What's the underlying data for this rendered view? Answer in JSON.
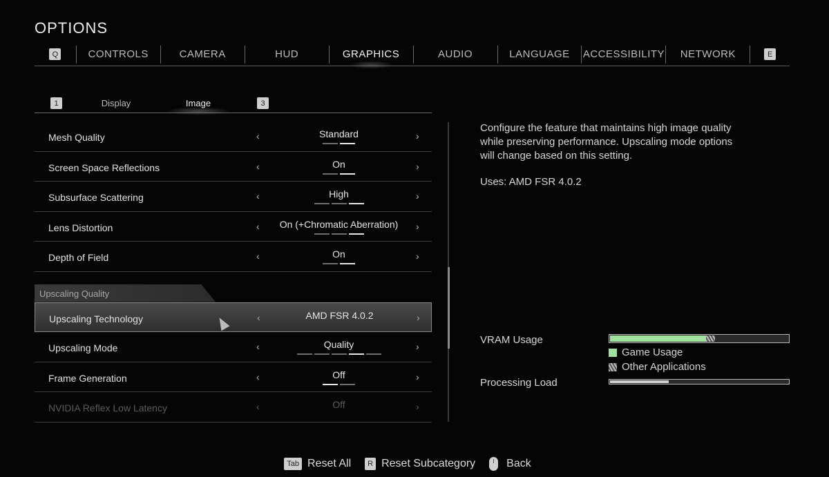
{
  "header": {
    "title": "OPTIONS"
  },
  "topnav": {
    "left_key": "Q",
    "right_key": "E",
    "tabs": [
      "CONTROLS",
      "CAMERA",
      "HUD",
      "GRAPHICS",
      "AUDIO",
      "LANGUAGE",
      "ACCESSIBILITY",
      "NETWORK"
    ],
    "active": "GRAPHICS"
  },
  "subnav": {
    "left_key": "1",
    "right_key": "3",
    "tabs": [
      "Display",
      "Image"
    ],
    "active": "Image"
  },
  "settings": [
    {
      "label": "Mesh Quality",
      "value": "Standard",
      "pips": 2,
      "active_pip": 2
    },
    {
      "label": "Screen Space Reflections",
      "value": "On",
      "pips": 2,
      "active_pip": 2
    },
    {
      "label": "Subsurface Scattering",
      "value": "High",
      "pips": 3,
      "active_pip": 3
    },
    {
      "label": "Lens Distortion",
      "value": "On (+Chromatic Aberration)",
      "pips": 3,
      "active_pip": 3
    }
  ],
  "settings_extra": [
    {
      "label": "Depth of Field",
      "value": "On",
      "pips": 2,
      "active_pip": 2
    }
  ],
  "section": {
    "title": "Upscaling Quality"
  },
  "upscaling": [
    {
      "label": "Upscaling Technology",
      "value": "AMD FSR 4.0.2",
      "pips": 0,
      "active_pip": 0,
      "selected": true
    },
    {
      "label": "Upscaling Mode",
      "value": "Quality",
      "pips": 5,
      "active_pip": 4
    },
    {
      "label": "Frame Generation",
      "value": "Off",
      "pips": 2,
      "active_pip": 1
    },
    {
      "label": "NVIDIA Reflex Low Latency",
      "value": "Off",
      "pips": 0,
      "active_pip": 0,
      "disabled": true
    }
  ],
  "description": {
    "text": "Configure the feature that maintains high image quality while preserving performance. Upscaling mode options will change based on this setting.",
    "uses": "Uses: AMD FSR 4.0.2"
  },
  "meters": {
    "vram_label": "VRAM Usage",
    "vram_game_fraction": 0.54,
    "vram_other_fraction": 0.05,
    "legend_game": "Game Usage",
    "legend_other": "Other Applications",
    "load_label": "Processing Load",
    "load_fraction": 0.33,
    "game_color": "#9ee29e"
  },
  "footer": {
    "reset_all_key": "Tab",
    "reset_all": "Reset All",
    "reset_sub_key": "R",
    "reset_sub": "Reset Subcategory",
    "back": "Back"
  }
}
